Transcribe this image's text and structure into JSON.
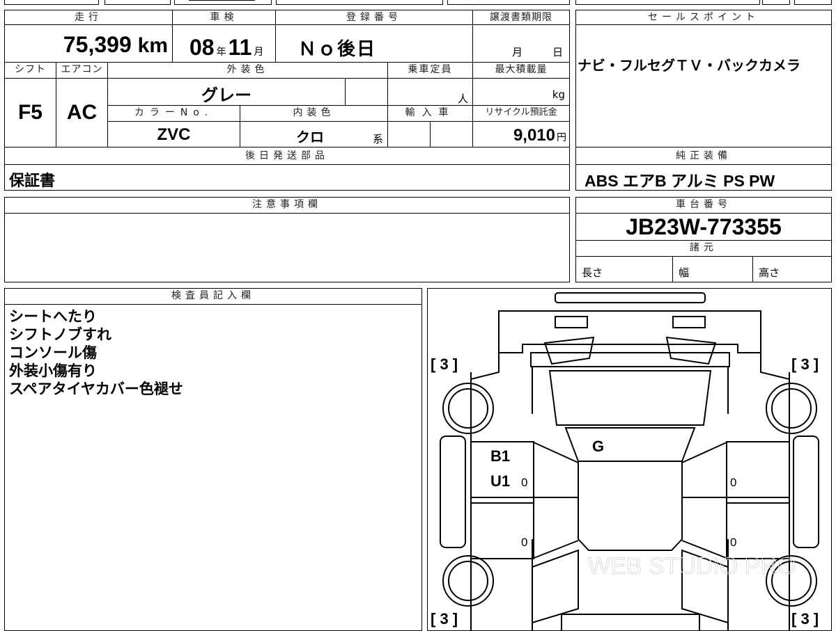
{
  "top_strip": {
    "fragment_1": "",
    "fragment_2": ""
  },
  "vehicle": {
    "mileage_header": "走行",
    "mileage_value": "75,399",
    "mileage_unit": "km",
    "inspection_header": "車検",
    "inspection_year": "08",
    "inspection_year_unit": "年",
    "inspection_month": "11",
    "inspection_month_unit": "月",
    "registration_header": "登録番号",
    "registration_value": "Ｎｏ後日",
    "transfer_deadline_header": "譲渡書類期限",
    "transfer_month_unit": "月",
    "transfer_day_unit": "日",
    "shift_header": "シフト",
    "shift_value": "F5",
    "ac_header": "エアコン",
    "ac_value": "AC",
    "exterior_color_header": "外装色",
    "exterior_color_value": "グレー",
    "capacity_header": "乗車定員",
    "capacity_unit": "人",
    "max_load_header": "最大積載量",
    "max_load_unit": "kg",
    "color_no_header": "カラーNo.",
    "color_no_value": "ZVC",
    "interior_color_header": "内装色",
    "interior_color_value": "クロ",
    "interior_color_suffix": "系",
    "import_header": "輸入車",
    "recycle_header": "リサイクル預託金",
    "recycle_value": "9,010",
    "recycle_unit": "円",
    "later_parts_header": "後日発送部品",
    "later_parts_value": "保証書"
  },
  "sales_point": {
    "header": "セールスポイント",
    "value": "ナビ・フルセグＴＶ・バックカメラ"
  },
  "standard_equipment": {
    "header": "純正装備",
    "value": "ABS エアB アルミ PS PW"
  },
  "notes": {
    "header": "注意事項欄",
    "value": ""
  },
  "chassis": {
    "header": "車台番号",
    "value": "JB23W-773355",
    "specs_header": "諸元",
    "length_label": "長さ",
    "width_label": "幅",
    "height_label": "高さ"
  },
  "inspector": {
    "header": "検査員記入欄",
    "lines": [
      "シートへたり",
      "シフトノブすれ",
      "コンソール傷",
      "外装小傷有り",
      "スペアタイヤカバー色褪せ"
    ]
  },
  "diagram": {
    "tire_front_left": "[ 3 ]",
    "tire_front_right": "[ 3 ]",
    "tire_rear_left": "[ 3 ]",
    "tire_rear_right": "[ 3 ]",
    "mark_windshield": "G",
    "mark_front_door_1": "B1",
    "mark_front_door_2": "U1",
    "door_fl_value": "0",
    "door_fr_value": "0",
    "door_rl_value": "0",
    "door_rr_value": "0",
    "watermark": "WEB STUDIO PRO"
  }
}
